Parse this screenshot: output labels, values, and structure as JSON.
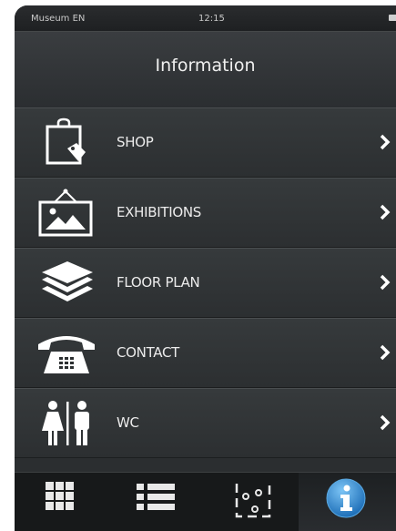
{
  "status_bar": {
    "carrier": "Museum  EN",
    "time": "12:15"
  },
  "nav": {
    "title": "Information"
  },
  "menu": [
    {
      "label": "SHOP",
      "icon": "shopping-bag-icon"
    },
    {
      "label": "EXHIBITIONS",
      "icon": "framed-picture-icon"
    },
    {
      "label": "FLOOR PLAN",
      "icon": "layers-icon"
    },
    {
      "label": "CONTACT",
      "icon": "telephone-icon"
    },
    {
      "label": "WC",
      "icon": "restroom-icon"
    }
  ],
  "tabs": [
    {
      "icon": "keypad-icon",
      "active": false
    },
    {
      "icon": "list-icon",
      "active": false
    },
    {
      "icon": "map-icon",
      "active": false
    },
    {
      "icon": "info-icon",
      "active": true
    }
  ],
  "colors": {
    "background": "#2b2e30",
    "text": "#ececec",
    "accent_blue": "#2f8fd8"
  }
}
